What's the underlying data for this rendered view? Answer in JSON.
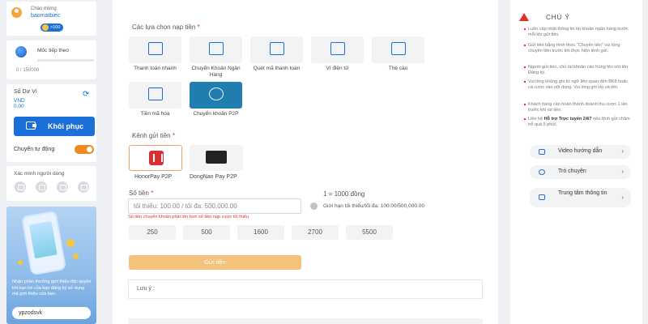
{
  "user": {
    "greeting": "Chào mừng",
    "username": "baomatbiec",
    "vip_badge": ">100"
  },
  "level": {
    "label": "Mốc tiếp theo",
    "progress_text": "0 / 150000"
  },
  "balance": {
    "title": "Số Dư Ví",
    "currency": "VND",
    "amount": "0.00",
    "restore_label": "Khôi phục",
    "auto_transfer_label": "Chuyển tự động",
    "auto_transfer_on": true
  },
  "verification": {
    "title": "Xác minh người dùng"
  },
  "promo": {
    "text": "Nhận phần thưởng giới thiệu độc quyền khi bạn bè của bạn đăng ký sử dụng mã giới thiệu của bạn.",
    "referral_code": "ypzodsvk"
  },
  "deposit": {
    "options_title": "Các lựa chọn nạp tiền",
    "options": [
      {
        "label": "Thanh toán nhanh",
        "icon": "fast-pay-icon"
      },
      {
        "label": "Chuyển Khoản Ngân Hàng",
        "icon": "bank-transfer-icon"
      },
      {
        "label": "Quét mã thanh toán",
        "icon": "scan-code-icon"
      },
      {
        "label": "Ví điện tử",
        "icon": "qr-wallet-icon"
      },
      {
        "label": "Thẻ cào",
        "icon": "scratch-card-icon"
      },
      {
        "label": "Tiền mã hóa",
        "icon": "crypto-icon"
      },
      {
        "label": "Chuyển khoản P2P",
        "icon": "p2p-icon"
      }
    ],
    "channel_title": "Kênh gửi tiền",
    "channels": [
      {
        "label": "HonorPay P2P",
        "selected": true
      },
      {
        "label": "DongNan Pay P2P",
        "selected": false
      }
    ],
    "amount_label": "Số tiền",
    "amount_placeholder": "tối thiểu: 100.00 / tối đa: 500,000.00",
    "amount_error": "Số tiền chuyển khoản phải lớn hơn số tiền nạp cược tối thiểu",
    "rate": "1 = 1000 đồng",
    "limit_text": "Giới hạn tối thiểu/tối đa: 100.00/500,000.00",
    "quick_amounts": [
      "250",
      "500",
      "1600",
      "2700",
      "5500"
    ],
    "submit_label": "Gửi tiền",
    "note_label": "Lưu ý :"
  },
  "notes": {
    "title": "CHÚ Ý",
    "rules": [
      "Luôn cập nhật thông tin tài khoản ngân hàng trước mỗi khi gửi tiền.",
      "Gửi tiền bằng hình thức \"Chuyển tiền\" vui lòng chuyển tiền trước khi thực hiện lệnh gửi.",
      "Người gửi tiền, chủ tài khoản cần trùng tên với tên Đăng ký.",
      "Vui lòng không ghi từ ngữ liên quan đến BK8 hoặc cá cược vào nội dung. Vui lòng ghi Họ và tên.",
      "Khách hàng cần hoàn thành doanh thu cược 1 lần trước khi rút tiền."
    ],
    "last_rule_prefix": "Liên hệ ",
    "last_rule_bold": "Hỗ trợ Trực tuyến 24/7",
    "last_rule_suffix": " nếu lệnh gửi chậm trễ quá 5 phút."
  },
  "help": {
    "items": [
      {
        "label": "Video hướng dẫn",
        "icon": "video-icon"
      },
      {
        "label": "Trò chuyện",
        "icon": "chat-icon"
      },
      {
        "label": "Trung tâm thông tin",
        "icon": "info-center-icon"
      }
    ]
  },
  "colors": {
    "primary": "#1a6fd8",
    "accent": "#f08a1c",
    "danger": "#e0302a",
    "submit_disabled": "#f5c27c"
  }
}
